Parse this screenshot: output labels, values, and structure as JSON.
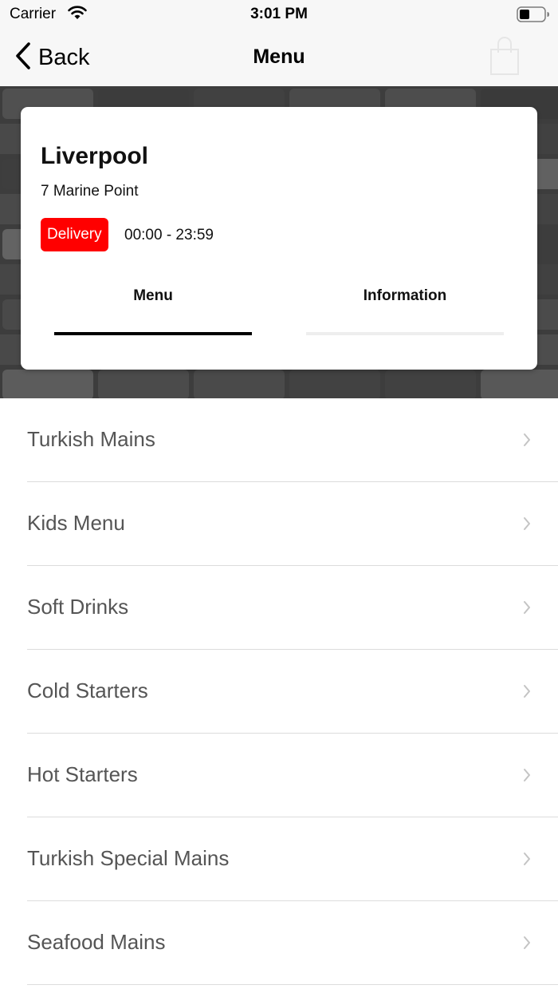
{
  "status_bar": {
    "carrier": "Carrier",
    "time": "3:01 PM",
    "icons": [
      "wifi-icon",
      "battery-icon"
    ]
  },
  "nav": {
    "back_label": "Back",
    "title": "Menu",
    "icons": [
      "chevron-left-icon",
      "shopping-bag-icon"
    ]
  },
  "store": {
    "name": "Liverpool",
    "address": "7 Marine Point",
    "delivery_label": "Delivery",
    "hours": "00:00 - 23:59",
    "tabs": [
      {
        "label": "Menu",
        "active": true
      },
      {
        "label": "Information",
        "active": false
      }
    ]
  },
  "menu": {
    "categories": [
      {
        "label": "Turkish Mains"
      },
      {
        "label": "Kids Menu"
      },
      {
        "label": "Soft Drinks"
      },
      {
        "label": "Cold Starters"
      },
      {
        "label": "Hot Starters"
      },
      {
        "label": "Turkish Special Mains"
      },
      {
        "label": "Seafood Mains"
      }
    ]
  },
  "colors": {
    "accent_red": "#ff0000",
    "nav_background": "#f7f7f7",
    "row_text": "#555555",
    "divider": "#dcdcdc"
  }
}
